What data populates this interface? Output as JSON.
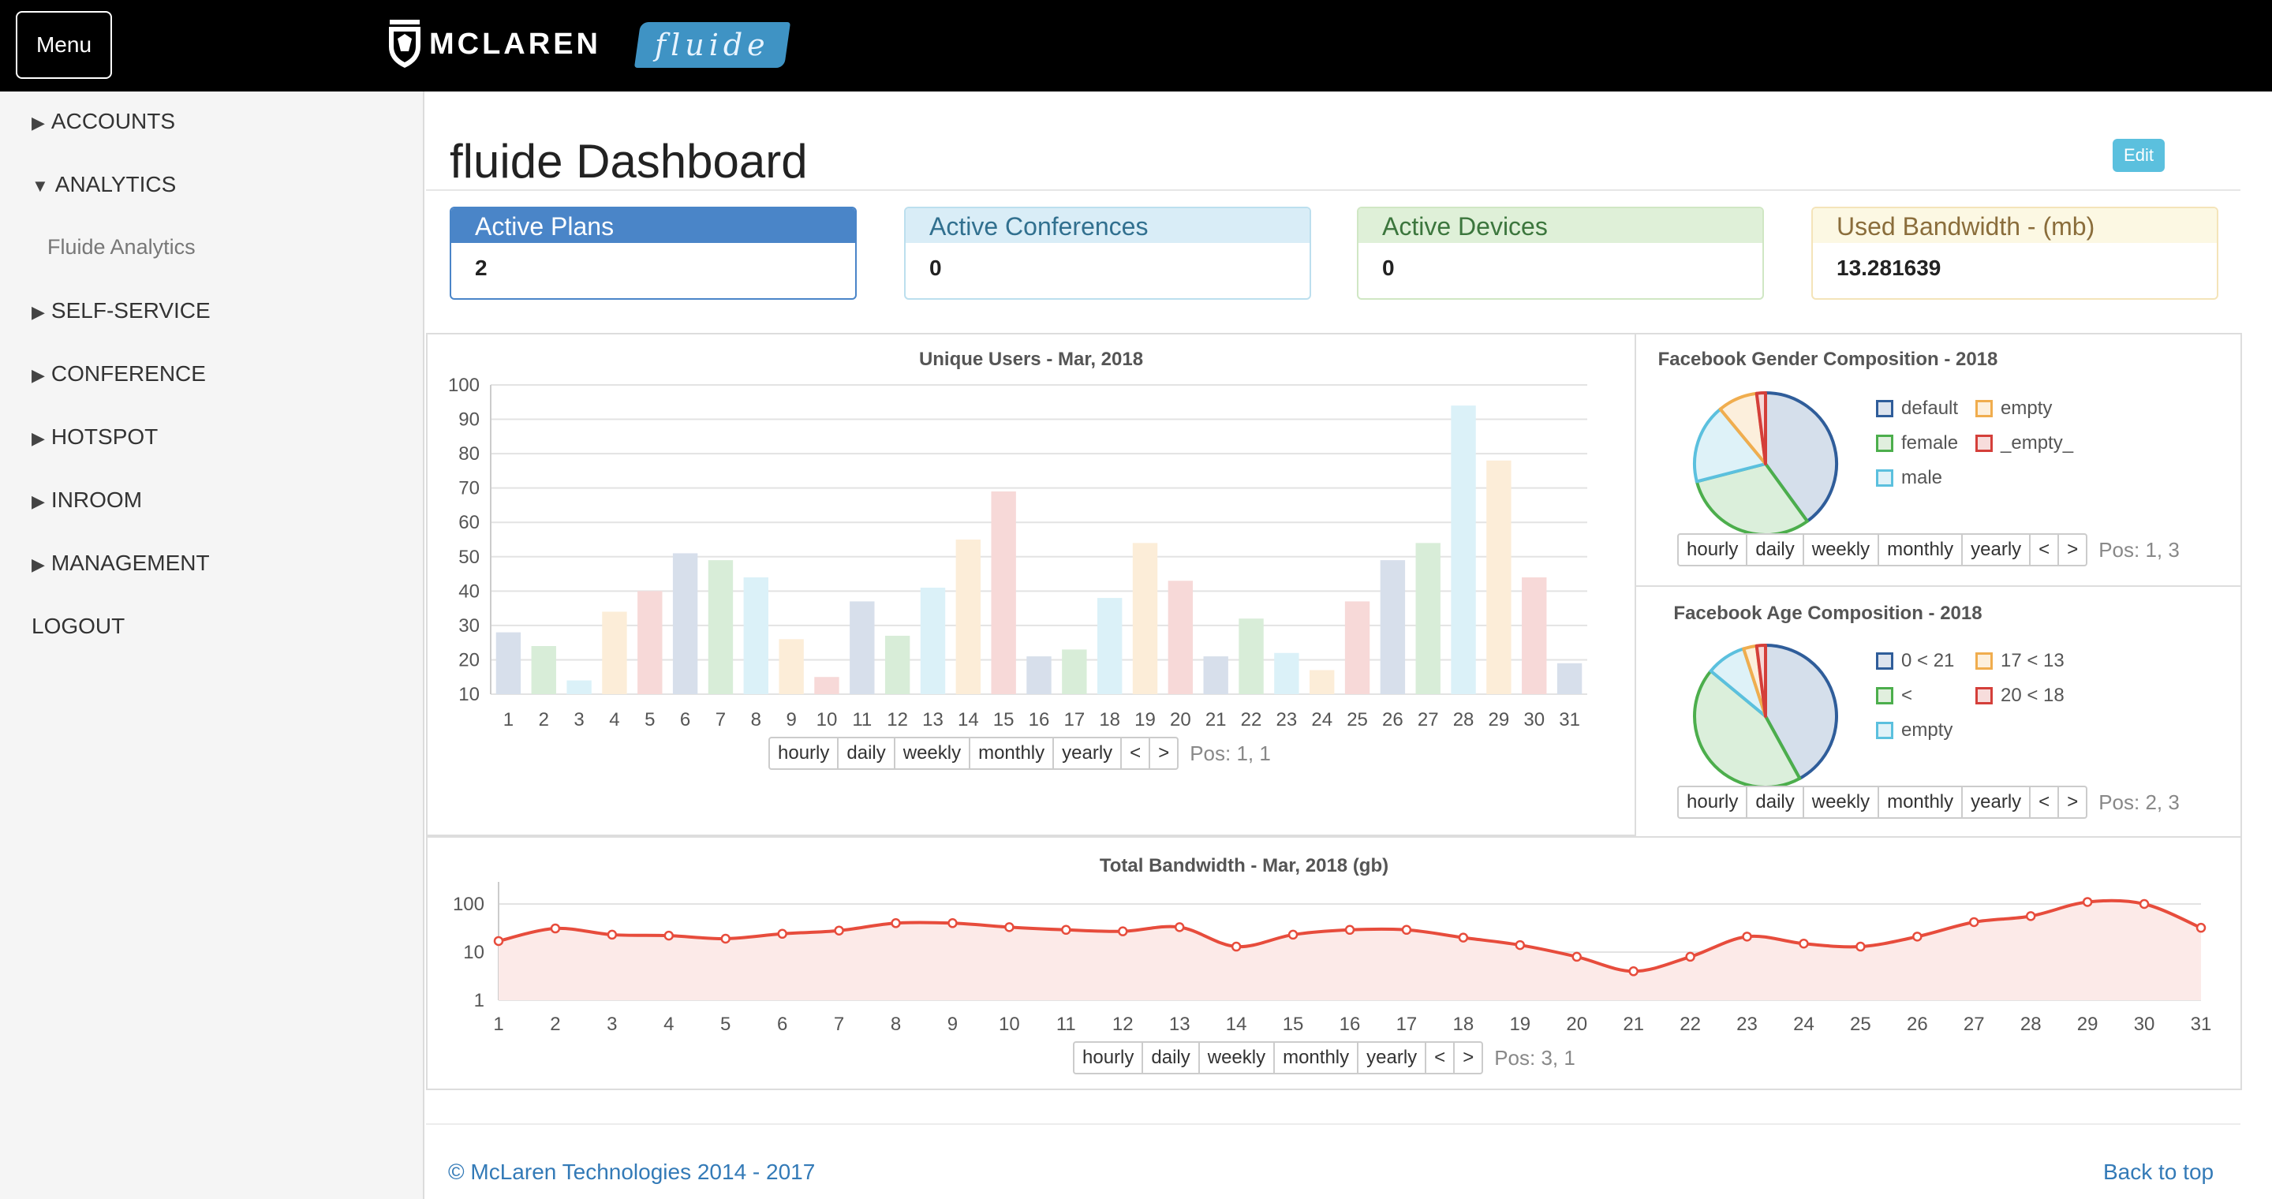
{
  "topbar": {
    "menu_label": "Menu",
    "brand_mclaren": "MCLAREN",
    "brand_fluide": "fluide"
  },
  "sidebar": {
    "items": [
      {
        "label": "ACCOUNTS",
        "expanded": false
      },
      {
        "label": "ANALYTICS",
        "expanded": true
      },
      {
        "label": "SELF-SERVICE",
        "expanded": false
      },
      {
        "label": "CONFERENCE",
        "expanded": false
      },
      {
        "label": "HOTSPOT",
        "expanded": false
      },
      {
        "label": "INROOM",
        "expanded": false
      },
      {
        "label": "MANAGEMENT",
        "expanded": false
      }
    ],
    "sub_item": "Fluide Analytics",
    "logout": "LOGOUT"
  },
  "page": {
    "title": "fluide Dashboard",
    "edit_label": "Edit"
  },
  "stats": [
    {
      "label": "Active Plans",
      "value": "2"
    },
    {
      "label": "Active Conferences",
      "value": "0"
    },
    {
      "label": "Active Devices",
      "value": "0"
    },
    {
      "label": "Used Bandwidth - (mb)",
      "value": "13.281639"
    }
  ],
  "period_buttons": [
    "hourly",
    "daily",
    "weekly",
    "monthly",
    "yearly"
  ],
  "nav_prev": "<",
  "nav_next": ">",
  "chart_data": [
    {
      "type": "bar",
      "title": "Unique Users - Mar, 2018",
      "categories": [
        "1",
        "2",
        "3",
        "4",
        "5",
        "6",
        "7",
        "8",
        "9",
        "10",
        "11",
        "12",
        "13",
        "14",
        "15",
        "16",
        "17",
        "18",
        "19",
        "20",
        "21",
        "22",
        "23",
        "24",
        "25",
        "26",
        "27",
        "28",
        "29",
        "30",
        "31"
      ],
      "values": [
        28,
        24,
        14,
        34,
        40,
        51,
        49,
        44,
        26,
        15,
        37,
        27,
        41,
        55,
        69,
        21,
        23,
        38,
        54,
        43,
        21,
        32,
        22,
        17,
        37,
        49,
        54,
        94,
        78,
        44,
        19
      ],
      "ylim": [
        10,
        100
      ],
      "yticks": [
        10,
        20,
        30,
        40,
        50,
        60,
        70,
        80,
        90,
        100
      ],
      "colors": [
        "#4a6fa5",
        "#4cae4c",
        "#5bc0de",
        "#f0ad4e",
        "#d9534f"
      ],
      "grid": true,
      "position_label": "Pos: 1, 1"
    },
    {
      "type": "pie",
      "title": "Facebook Gender Composition - 2018",
      "labels": [
        "default",
        "empty",
        "female",
        "_empty_",
        "male"
      ],
      "slice_order": [
        "default",
        "female",
        "male",
        "empty",
        "_empty_"
      ],
      "values": {
        "default": 40,
        "female": 31,
        "male": 18,
        "empty": 9,
        "_empty_": 2
      },
      "colors": {
        "default": "#2f5d9a",
        "empty": "#f0ad4e",
        "female": "#4cae4c",
        "_empty_": "#d43f3a",
        "male": "#5bc0de"
      },
      "legend": "right",
      "position_label": "Pos: 1, 3"
    },
    {
      "type": "pie",
      "title": "Facebook Age Composition - 2018",
      "labels": [
        "0 < 21",
        "17 < 13",
        "<",
        "20 < 18",
        "empty"
      ],
      "slice_order": [
        "0 < 21",
        "<",
        "empty",
        "17 < 13",
        "20 < 18"
      ],
      "values": {
        "0 < 21": 42,
        "<": 44,
        "empty": 9,
        "17 < 13": 3,
        "20 < 18": 2
      },
      "colors": {
        "0 < 21": "#2f5d9a",
        "17 < 13": "#f0ad4e",
        "<": "#4cae4c",
        "20 < 18": "#d43f3a",
        "empty": "#5bc0de"
      },
      "legend": "right",
      "position_label": "Pos: 2, 3"
    },
    {
      "type": "area",
      "title": "Total Bandwidth - Mar, 2018 (gb)",
      "scale": "log",
      "x": [
        "1",
        "2",
        "3",
        "4",
        "5",
        "6",
        "7",
        "8",
        "9",
        "10",
        "11",
        "12",
        "13",
        "14",
        "15",
        "16",
        "17",
        "18",
        "19",
        "20",
        "21",
        "22",
        "23",
        "24",
        "25",
        "26",
        "27",
        "28",
        "29",
        "30",
        "31"
      ],
      "values": [
        17,
        31,
        23,
        22,
        19,
        24,
        28,
        40,
        40,
        33,
        29,
        27,
        33,
        13,
        23,
        29,
        29,
        20,
        14,
        8,
        4,
        8,
        21,
        15,
        13,
        21,
        42,
        56,
        110,
        100,
        32
      ],
      "ylim": [
        1,
        100
      ],
      "yticks": [
        1,
        10,
        100
      ],
      "color": "#e74c3c",
      "position_label": "Pos: 3, 1"
    }
  ],
  "footer": {
    "copyright": "© McLaren Technologies 2014 - 2017",
    "back_to_top": "Back to top"
  }
}
